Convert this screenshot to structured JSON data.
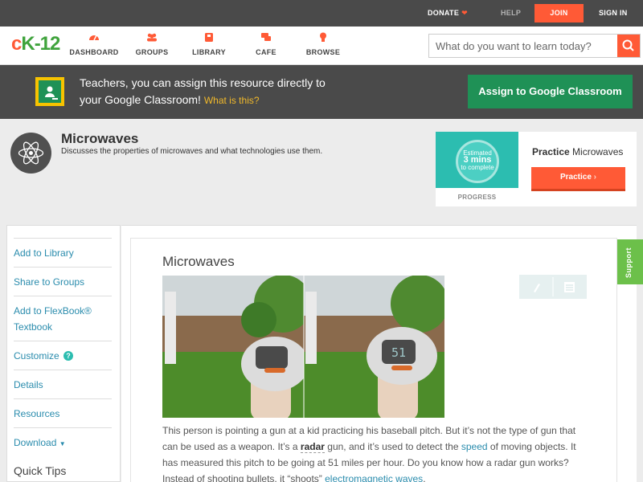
{
  "topbar": {
    "donate": "DONATE",
    "help": "HELP",
    "join": "JOIN",
    "signin": "SIGN IN"
  },
  "logo": {
    "c": "c",
    "k": "K-12"
  },
  "nav": {
    "dashboard": "DASHBOARD",
    "groups": "GROUPS",
    "library": "LIBRARY",
    "cafe": "CAFE",
    "browse": "BROWSE"
  },
  "search": {
    "placeholder": "What do you want to learn today?"
  },
  "banner": {
    "line1": "Teachers, you can assign this resource directly to",
    "line2": "your Google Classroom!",
    "what": "What is this?",
    "assign": "Assign to Google Classroom"
  },
  "concept": {
    "title": "Microwaves",
    "description": "Discusses the properties of microwaves and what technologies use them."
  },
  "practice": {
    "ring_top": "Estimated",
    "ring_num": "3 mins",
    "ring_bottom": "to complete",
    "progress": "PROGRESS",
    "title_bold": "Practice",
    "title_rest": "Microwaves",
    "button": "Practice"
  },
  "sidebar": {
    "items": [
      "Add to Library",
      "Share to Groups",
      "Add to FlexBook®",
      "Textbook",
      "Customize",
      "Details",
      "Resources",
      "Download"
    ],
    "quick_tips": "Quick Tips"
  },
  "main": {
    "title": "Microwaves",
    "para": {
      "p1": "This person is pointing a gun at a kid practicing his baseball pitch. But it’s not the type of gun that can be used as a weapon. It’s a",
      "radar": "radar",
      "p2": "gun, and it’s used to detect the",
      "speed": "speed",
      "p3": "of moving objects. It has measured this pitch to be going at 51 miles per hour. Do you know how a radar gun works? Instead of shooting bullets, it “shoots”",
      "em": "electromagnetic waves",
      "p4": "."
    },
    "display_reading": "51"
  },
  "support": "Support",
  "colors": {
    "accent": "#ff5a36",
    "green": "#1f9156",
    "teal": "#2cbdb0",
    "link": "#2a8cad",
    "dark": "#4a4a4a"
  }
}
